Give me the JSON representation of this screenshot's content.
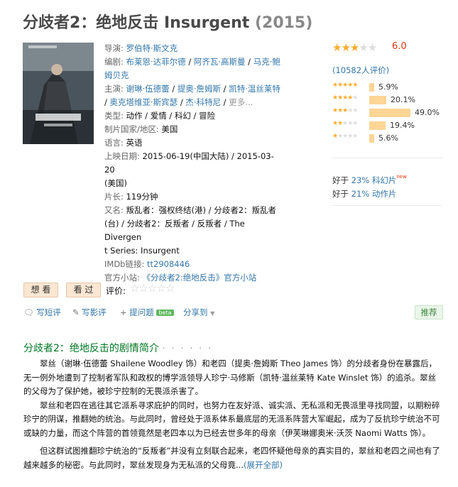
{
  "movie": {
    "title": "分歧者2：绝地反击 Insurgent",
    "year": "(2015)"
  },
  "info": {
    "director_label": "导演:",
    "director": "罗伯特·斯文克",
    "writer_label": "编剧:",
    "writers": [
      "布莱恩·达菲尔德",
      "阿齐瓦·高斯曼",
      "马克·鲍姆贝克"
    ],
    "cast_label": "主演:",
    "cast": [
      "谢琳·伍德蕾",
      "提奥·詹姆斯",
      "凯特·温丝莱特",
      "奥克塔维亚·斯宾瑟",
      "杰·科特尼"
    ],
    "more": "更多...",
    "genre_label": "类型:",
    "genre": "动作 / 爱情 / 科幻 / 冒险",
    "country_label": "制片国家/地区:",
    "country": "美国",
    "language_label": "语言:",
    "language": "英语",
    "release_label": "上映日期:",
    "release_1": "2015-06-19(中国大陆)",
    "release_sep": " / ",
    "release_2": "2015-03-20",
    "release_3": "(美国)",
    "runtime_label": "片长:",
    "runtime": "119分钟",
    "aka_label": "又名:",
    "aka_line1": "叛乱者：强权终结(港) / 分歧者2：叛乱者",
    "aka_line2": "(台) / 分歧者2：反叛者 / 反叛者 / The Divergen",
    "aka_line3": "t Series: Insurgent",
    "imdb_label": "IMDb链接:",
    "imdb": "tt2908446",
    "site_label": "官方小站:",
    "site": "《分歧者2:绝地反击》官方小站"
  },
  "rating": {
    "score": "6.0",
    "stars": 3,
    "votes": "(10582人评价)",
    "distribution": [
      {
        "stars": 5,
        "percent": 5.9,
        "label": "5.9%"
      },
      {
        "stars": 4,
        "percent": 20.1,
        "label": "20.1%"
      },
      {
        "stars": 3,
        "percent": 49.0,
        "label": "49.0%"
      },
      {
        "stars": 2,
        "percent": 19.4,
        "label": "19.4%"
      },
      {
        "stars": 1,
        "percent": 5.6,
        "label": "5.6%"
      }
    ],
    "better1_prefix": "好于 ",
    "better1_link": "23% 科幻片",
    "better1_new": "new",
    "better2_prefix": "好于 ",
    "better2_link": "21% 动作片"
  },
  "actions": {
    "want": "想 看",
    "seen": "看 过",
    "rate_label": "评价:",
    "write_short": "写短评",
    "write_review": "写影评",
    "ask": "提问题",
    "beta": "beta",
    "share": "分享到",
    "recommend": "推荐"
  },
  "summary": {
    "heading": "分歧者2：绝地反击的剧情简介",
    "dots": "· · · · · ·",
    "p1": "　　翠丝（谢琳·伍德蕾 Shailene Woodley 饰）和老四（提奥·詹姆斯 Theo James 饰）的分歧者身份在暴露后，无一例外地遭到了控制者军队和政权的博学派领导人珍宁·马修斯（凯特·温丝莱特 Kate Winslet 饰）的追杀。翠丝的父母为了保护她，被珍宁控制的无畏派杀害了。",
    "p2": "　　翠丝和老四在逃往其它派系寻求庇护的同时，也努力在友好派、诚实派、无私派和无畏派里寻找同盟，以期粉碎珍宁的阴谋，推翻她的统治。与此同时，曾经处于派系体系最底层的无派系阵营大军崛起，成为了反抗珍宁统治不可或缺的力量，而这个阵营的首领竟然是老四本以为已经去世多年的母亲（伊芙琳娜奥米·沃茨 Naomi Watts 饰）。",
    "p3": "　　但这群试图推翻珍宁统治的“反叛者”并没有立刻联合起来，老四怀疑他母亲的真实目的，翠丝和老四之间也有了越来越多的秘密。与此同时，翠丝发现身为无私派的父母竟...",
    "expand": "(展开全部)"
  }
}
